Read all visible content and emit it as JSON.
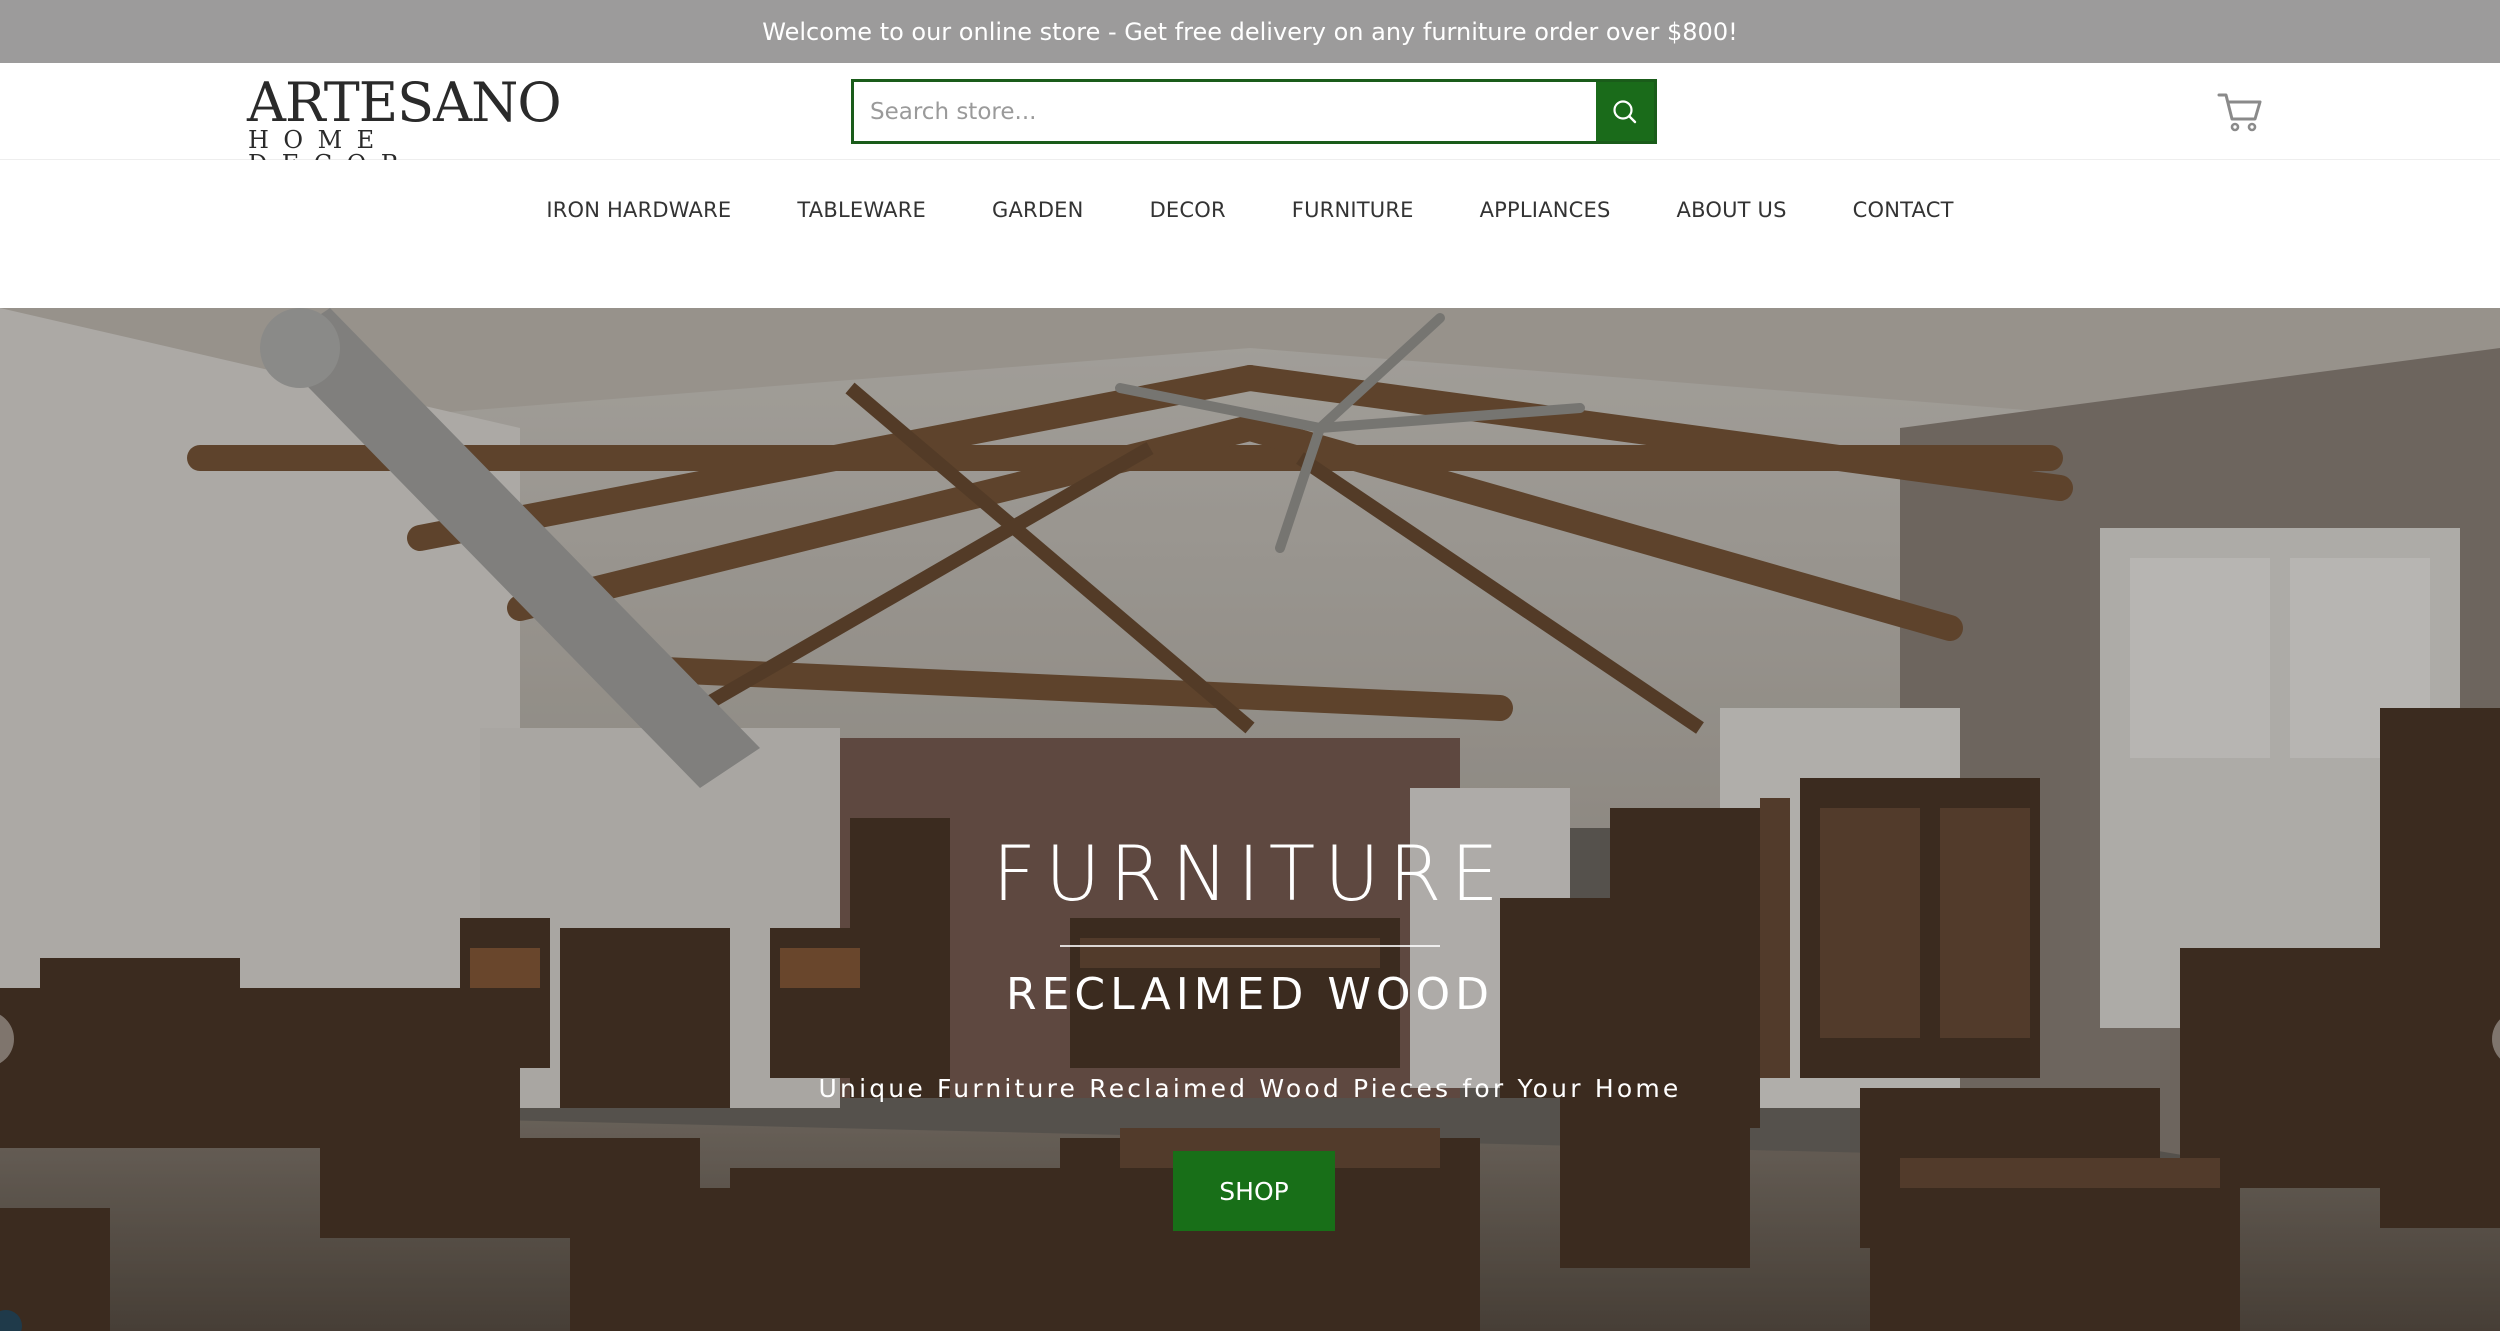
{
  "announcement": "Welcome to our online store - Get free delivery on any furniture order over $800!",
  "logo": {
    "line1": "ARTESANO",
    "line2": "HOME DECOR"
  },
  "search": {
    "placeholder": "Search store...",
    "icon": "search-icon"
  },
  "cart": {
    "icon": "cart-icon"
  },
  "nav": {
    "items": [
      {
        "label": "IRON HARDWARE"
      },
      {
        "label": "TABLEWARE"
      },
      {
        "label": "GARDEN"
      },
      {
        "label": "DECOR"
      },
      {
        "label": "FURNITURE"
      },
      {
        "label": "APPLIANCES"
      },
      {
        "label": "ABOUT US"
      },
      {
        "label": "CONTACT"
      }
    ]
  },
  "hero": {
    "title": "FURNITURE",
    "subtitle": "RECLAIMED WOOD",
    "tagline": "Unique Furniture Reclaimed Wood Pieces for Your Home",
    "button": "SHOP"
  },
  "colors": {
    "announcement_bg": "#9c9b9b",
    "brand_green": "#1a6b1a",
    "nav_text": "#333333"
  }
}
